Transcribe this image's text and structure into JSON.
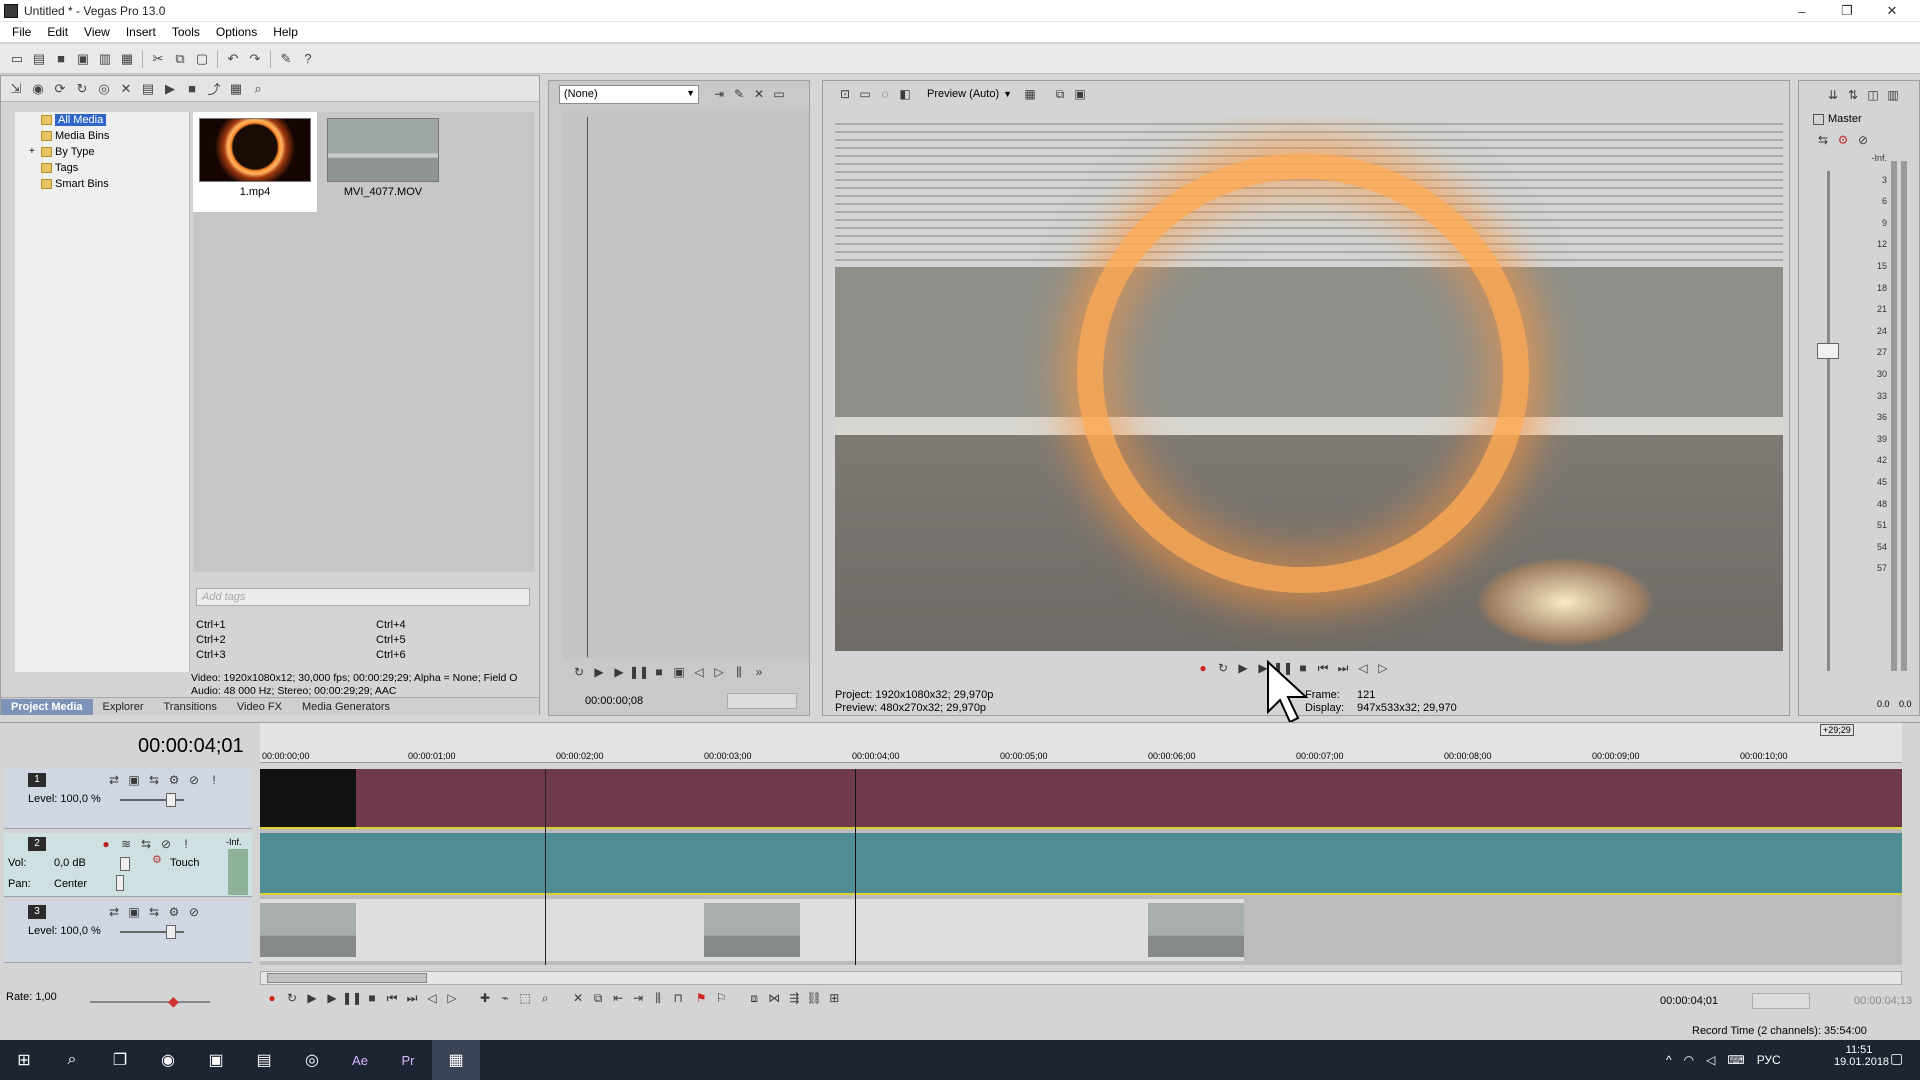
{
  "window": {
    "title": "Untitled * - Vegas Pro 13.0",
    "min": "–",
    "max": "❐",
    "close": "✕"
  },
  "menu": [
    "File",
    "Edit",
    "View",
    "Insert",
    "Tools",
    "Options",
    "Help"
  ],
  "explorer": {
    "tree": [
      "All Media",
      "Media Bins",
      "By Type",
      "Tags",
      "Smart Bins"
    ],
    "expand": "+",
    "thumbs": [
      "1.mp4",
      "MVI_4077.MOV"
    ],
    "tags_placeholder": "Add tags",
    "shortcuts": [
      [
        "Ctrl+1",
        "Ctrl+4"
      ],
      [
        "Ctrl+2",
        "Ctrl+5"
      ],
      [
        "Ctrl+3",
        "Ctrl+6"
      ]
    ],
    "info1": "Video: 1920x1080x12; 30,000 fps; 00:00:29;29; Alpha = None; Field O",
    "info2": "Audio: 48 000 Hz; Stereo; 00:00:29;29; AAC",
    "tabs": [
      "Project Media",
      "Explorer",
      "Transitions",
      "Video FX",
      "Media Generators"
    ]
  },
  "trimmer": {
    "dropdown": "(None)",
    "time": "00:00:00;08"
  },
  "preview": {
    "mode": "Preview (Auto)",
    "project": "Project:  1920x1080x32; 29,970p",
    "preview": "Preview:  480x270x32; 29,970p",
    "frame_label": "Frame:",
    "frame": "121",
    "display_label": "Display:",
    "display": "947x533x32; 29,970"
  },
  "master": {
    "title": "Master",
    "scale": [
      "-Inf.",
      "3",
      "6",
      "9",
      "12",
      "15",
      "18",
      "21",
      "24",
      "27",
      "30",
      "33",
      "36",
      "39",
      "42",
      "45",
      "48",
      "51",
      "54",
      "57"
    ],
    "left": "0.0",
    "right": "0.0"
  },
  "timeline": {
    "timecode": "00:00:04;01",
    "ruler": [
      "00:00:00;00",
      "00:00:01;00",
      "00:00:02;00",
      "00:00:03;00",
      "00:00:04;00",
      "00:00:05;00",
      "00:00:06;00",
      "00:00:07;00",
      "00:00:08;00",
      "00:00:09;00",
      "00:00:10;00"
    ],
    "end_badge": "+29;29",
    "tracks": [
      {
        "num": "1",
        "label1": "Level: 100,0 %"
      },
      {
        "num": "2",
        "vol": "Vol:",
        "vol_val": "0,0 dB",
        "touch": "Touch",
        "pan": "Pan:",
        "pan_val": "Center",
        "inf": "-Inf."
      },
      {
        "num": "3",
        "label1": "Level: 100,0 %"
      }
    ],
    "rate": "Rate: 1,00",
    "cursor_time": "00:00:04;01",
    "end_time": "00:00:04;13",
    "record": "Record Time (2 channels): 35:54:00"
  },
  "taskbar": {
    "lang": "РУС",
    "time": "11:51",
    "date": "19.01.2018",
    "apps": [
      "Ae",
      "Pr"
    ]
  },
  "colors": {
    "accent": "#2e65c8",
    "track_video": "#6f3b4a",
    "track_audio": "#4f8c93",
    "taskbar": "#1d2533"
  }
}
